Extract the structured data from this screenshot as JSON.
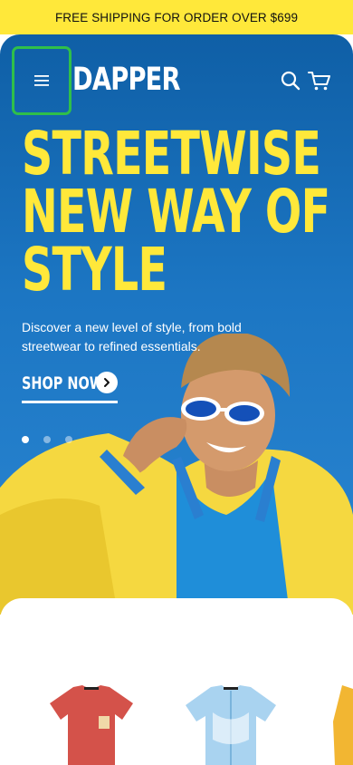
{
  "announcement": {
    "text": "FREE SHIPPING FOR ORDER OVER $699"
  },
  "header": {
    "logo": "DAPPER",
    "menu_icon": "hamburger-menu-icon",
    "search_icon": "search-icon",
    "cart_icon": "cart-icon"
  },
  "hero": {
    "headline": [
      "STREETWISE",
      "NEW WAY OF",
      "STYLE"
    ],
    "subtext": "Discover a new level of style, from bold streetwear to refined essentials.",
    "cta_label": "SHOP NOW",
    "cta_icon": "chevron-right-icon",
    "carousel": {
      "slides": 3,
      "active": 1
    }
  },
  "products": [
    {
      "name": "red-graphic-tee",
      "color": "#d4524a"
    },
    {
      "name": "light-blue-shirt",
      "color": "#a9d3f0"
    },
    {
      "name": "yellow-jacket",
      "color": "#f2b632"
    }
  ],
  "colors": {
    "accent_yellow": "#ffe83a",
    "hero_blue": "#1c76c3",
    "focus_green": "#2fbf4a"
  }
}
